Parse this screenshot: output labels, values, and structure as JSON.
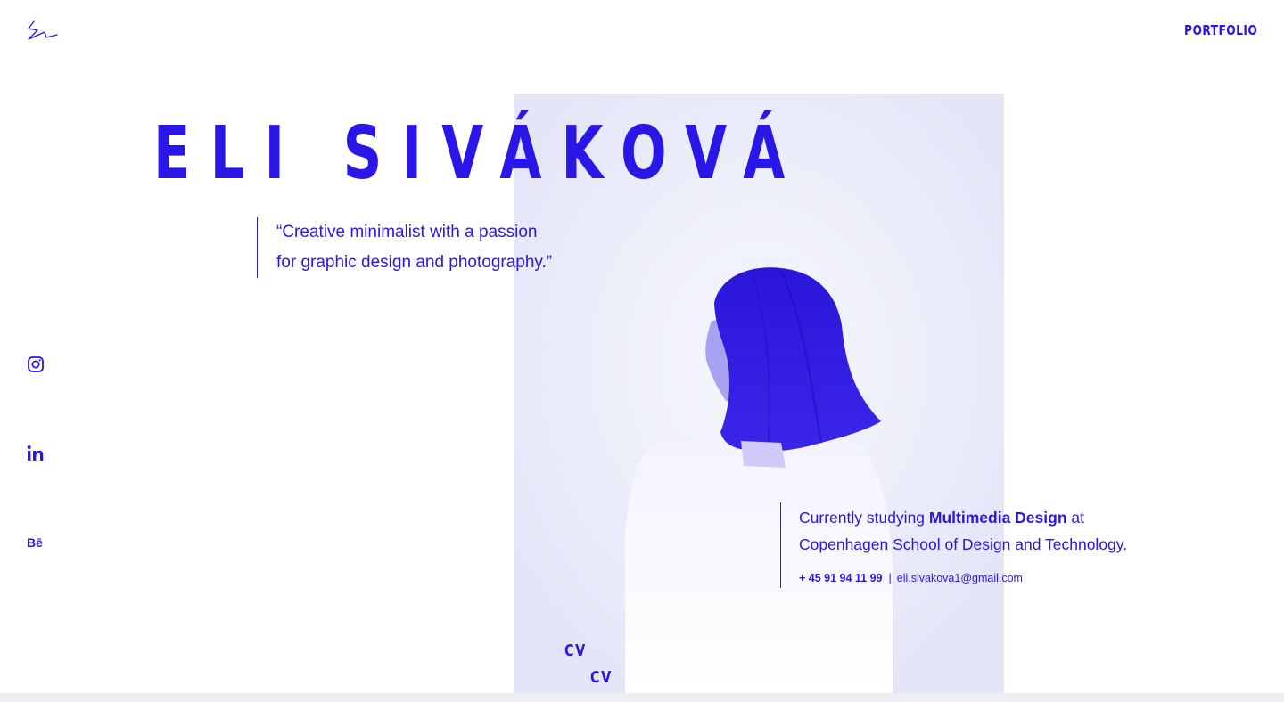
{
  "header": {
    "portfolio_label": "PORTFOLIO"
  },
  "hero": {
    "name": "ELI SIVÁKOVÁ",
    "quote_line1": "“Creative minimalist with a passion",
    "quote_line2": "for graphic design and photography.”"
  },
  "social": {
    "behance_label": "Bē"
  },
  "about": {
    "studying_prefix": "Currently studying ",
    "program": "Multimedia Design",
    "studying_suffix": " at",
    "school": "Copenhagen School of Design and Technology.",
    "phone": "+ 45 91 94 11 99",
    "separator": "|",
    "email": "eli.sivakova1@gmail.com"
  },
  "cv": {
    "label_1": "CV",
    "label_2": "CV"
  },
  "colors": {
    "accent": "#2a16e6",
    "background": "#ffffff"
  },
  "icons": [
    "logo-icon",
    "instagram-icon",
    "linkedin-icon",
    "behance-icon"
  ]
}
